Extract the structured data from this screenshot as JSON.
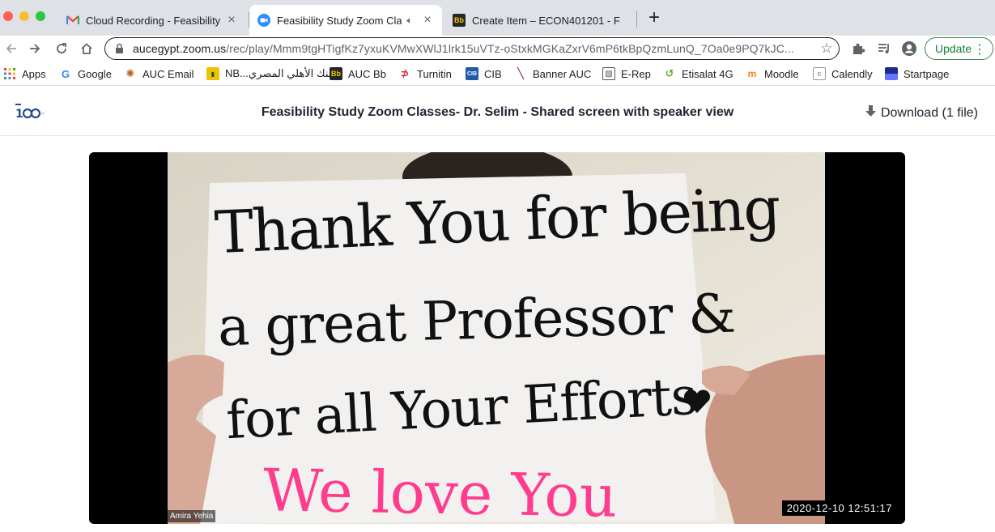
{
  "browser": {
    "tabs": [
      {
        "title": "Cloud Recording - Feasibility S",
        "favicon": "gmail-icon",
        "active": false
      },
      {
        "title": "Feasibility Study Zoom Cla",
        "favicon": "zoom-icon",
        "active": true
      },
      {
        "title": "Create Item – ECON401201 - F",
        "favicon": "blackboard-icon",
        "active": false
      }
    ],
    "url_host": "aucegypt.zoom.us",
    "url_path": "/rec/play/Mmm9tgHTigfKz7yxuKVMwXWlJ1lrk15uVTz-oStxkMGKaZxrV6mP6tkBpQzmLunQ_7Oa0e9PQ7kJC...",
    "update_label": "Update",
    "bookmarks": [
      {
        "label": "Apps",
        "icon": "apps-grid-icon"
      },
      {
        "label": "Google",
        "icon": "google-icon"
      },
      {
        "label": "AUC Email",
        "icon": "auc-email-icon"
      },
      {
        "label": "NB...البنك الأهلي المصري",
        "icon": "nbe-icon"
      },
      {
        "label": "AUC Bb",
        "icon": "blackboard-icon"
      },
      {
        "label": "Turnitin",
        "icon": "turnitin-icon"
      },
      {
        "label": "CIB",
        "icon": "cib-icon"
      },
      {
        "label": "Banner AUC",
        "icon": "banner-icon"
      },
      {
        "label": "E-Rep",
        "icon": "erep-icon"
      },
      {
        "label": "Etisalat 4G",
        "icon": "etisalat-icon"
      },
      {
        "label": "Moodle",
        "icon": "moodle-icon"
      },
      {
        "label": "Calendly",
        "icon": "calendly-icon"
      },
      {
        "label": "Startpage",
        "icon": "startpage-icon"
      }
    ]
  },
  "page": {
    "title": "Feasibility Study Zoom Classes- Dr. Selim - Shared screen with speaker view",
    "download_label": "Download (1 file)"
  },
  "video": {
    "speaker_name": "Amira Yehia",
    "timestamp": "2020-12-10  12:51:17",
    "sign_lines": [
      "Thank You for being",
      "a great Professor &",
      "for all Your Efforts",
      "We love You"
    ]
  },
  "colors": {
    "tabstrip": "#dee1e6",
    "update_green": "#188038",
    "sign_pink": "#ff3c8e"
  }
}
